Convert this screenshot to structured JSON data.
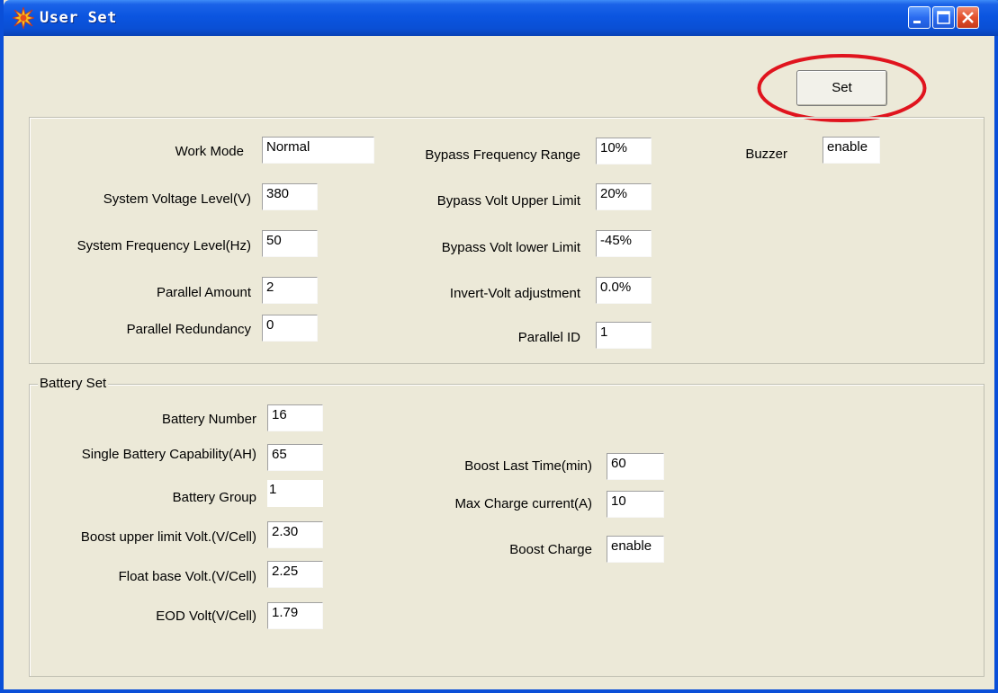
{
  "window": {
    "title": "User Set"
  },
  "toolbar": {
    "set_label": "Set"
  },
  "system": {
    "work_mode": {
      "label": "Work Mode",
      "value": "Normal"
    },
    "system_voltage": {
      "label": "System Voltage Level(V)",
      "value": "380"
    },
    "system_frequency": {
      "label": "System Frequency Level(Hz)",
      "value": "50"
    },
    "parallel_amount": {
      "label": "Parallel Amount",
      "value": "2"
    },
    "parallel_redundancy": {
      "label": "Parallel Redundancy",
      "value": "0"
    },
    "bypass_frequency_range": {
      "label": "Bypass Frequency Range",
      "value": "10%"
    },
    "bypass_volt_upper": {
      "label": "Bypass Volt Upper Limit",
      "value": "20%"
    },
    "bypass_volt_lower": {
      "label": "Bypass Volt lower Limit",
      "value": "-45%"
    },
    "invert_volt_adjust": {
      "label": "Invert-Volt adjustment",
      "value": "0.0%"
    },
    "parallel_id": {
      "label": "Parallel ID",
      "value": "1"
    },
    "buzzer": {
      "label": "Buzzer",
      "value": "enable"
    }
  },
  "battery": {
    "group_title": "Battery Set",
    "battery_number": {
      "label": "Battery Number",
      "value": "16"
    },
    "single_capability": {
      "label": "Single Battery Capability(AH)",
      "value": "65"
    },
    "battery_group": {
      "label": "Battery Group",
      "value": "1"
    },
    "boost_upper": {
      "label": "Boost upper limit Volt.(V/Cell)",
      "value": "2.30"
    },
    "float_base": {
      "label": "Float base Volt.(V/Cell)",
      "value": "2.25"
    },
    "eod_volt": {
      "label": "EOD Volt(V/Cell)",
      "value": "1.79"
    },
    "boost_last_time": {
      "label": "Boost Last Time(min)",
      "value": "60"
    },
    "max_charge_current": {
      "label": "Max Charge current(A)",
      "value": "10"
    },
    "boost_charge": {
      "label": "Boost Charge",
      "value": "enable"
    }
  },
  "colors": {
    "titlebar": "#0a4fd8",
    "window_bg": "#ece9d8",
    "highlight_ellipse": "#e0141e",
    "close_button": "#e2502c"
  },
  "icons": {
    "app": "starburst-icon",
    "minimize": "minimize-icon",
    "maximize": "maximize-icon",
    "close": "close-icon"
  }
}
